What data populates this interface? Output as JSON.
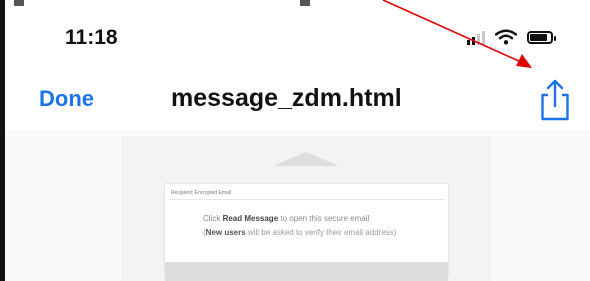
{
  "status_bar": {
    "time": "11:18",
    "signal_icon": "cellular-signal-icon",
    "wifi_icon": "wifi-icon",
    "battery_icon": "battery-icon"
  },
  "nav_bar": {
    "done_label": "Done",
    "title": "message_zdm.html",
    "share_icon": "share-icon",
    "accent_color": "#1a73e8"
  },
  "email": {
    "header": "Recipient: Encrypted Email",
    "line1_prefix": "Click ",
    "line1_bold": "Read Message",
    "line1_suffix": " to open this secure email",
    "line2_prefix": "(",
    "line2_bold": "New users",
    "line2_suffix": " will be asked to verify their email address)"
  },
  "annotation": {
    "arrow_color": "#e00000"
  }
}
